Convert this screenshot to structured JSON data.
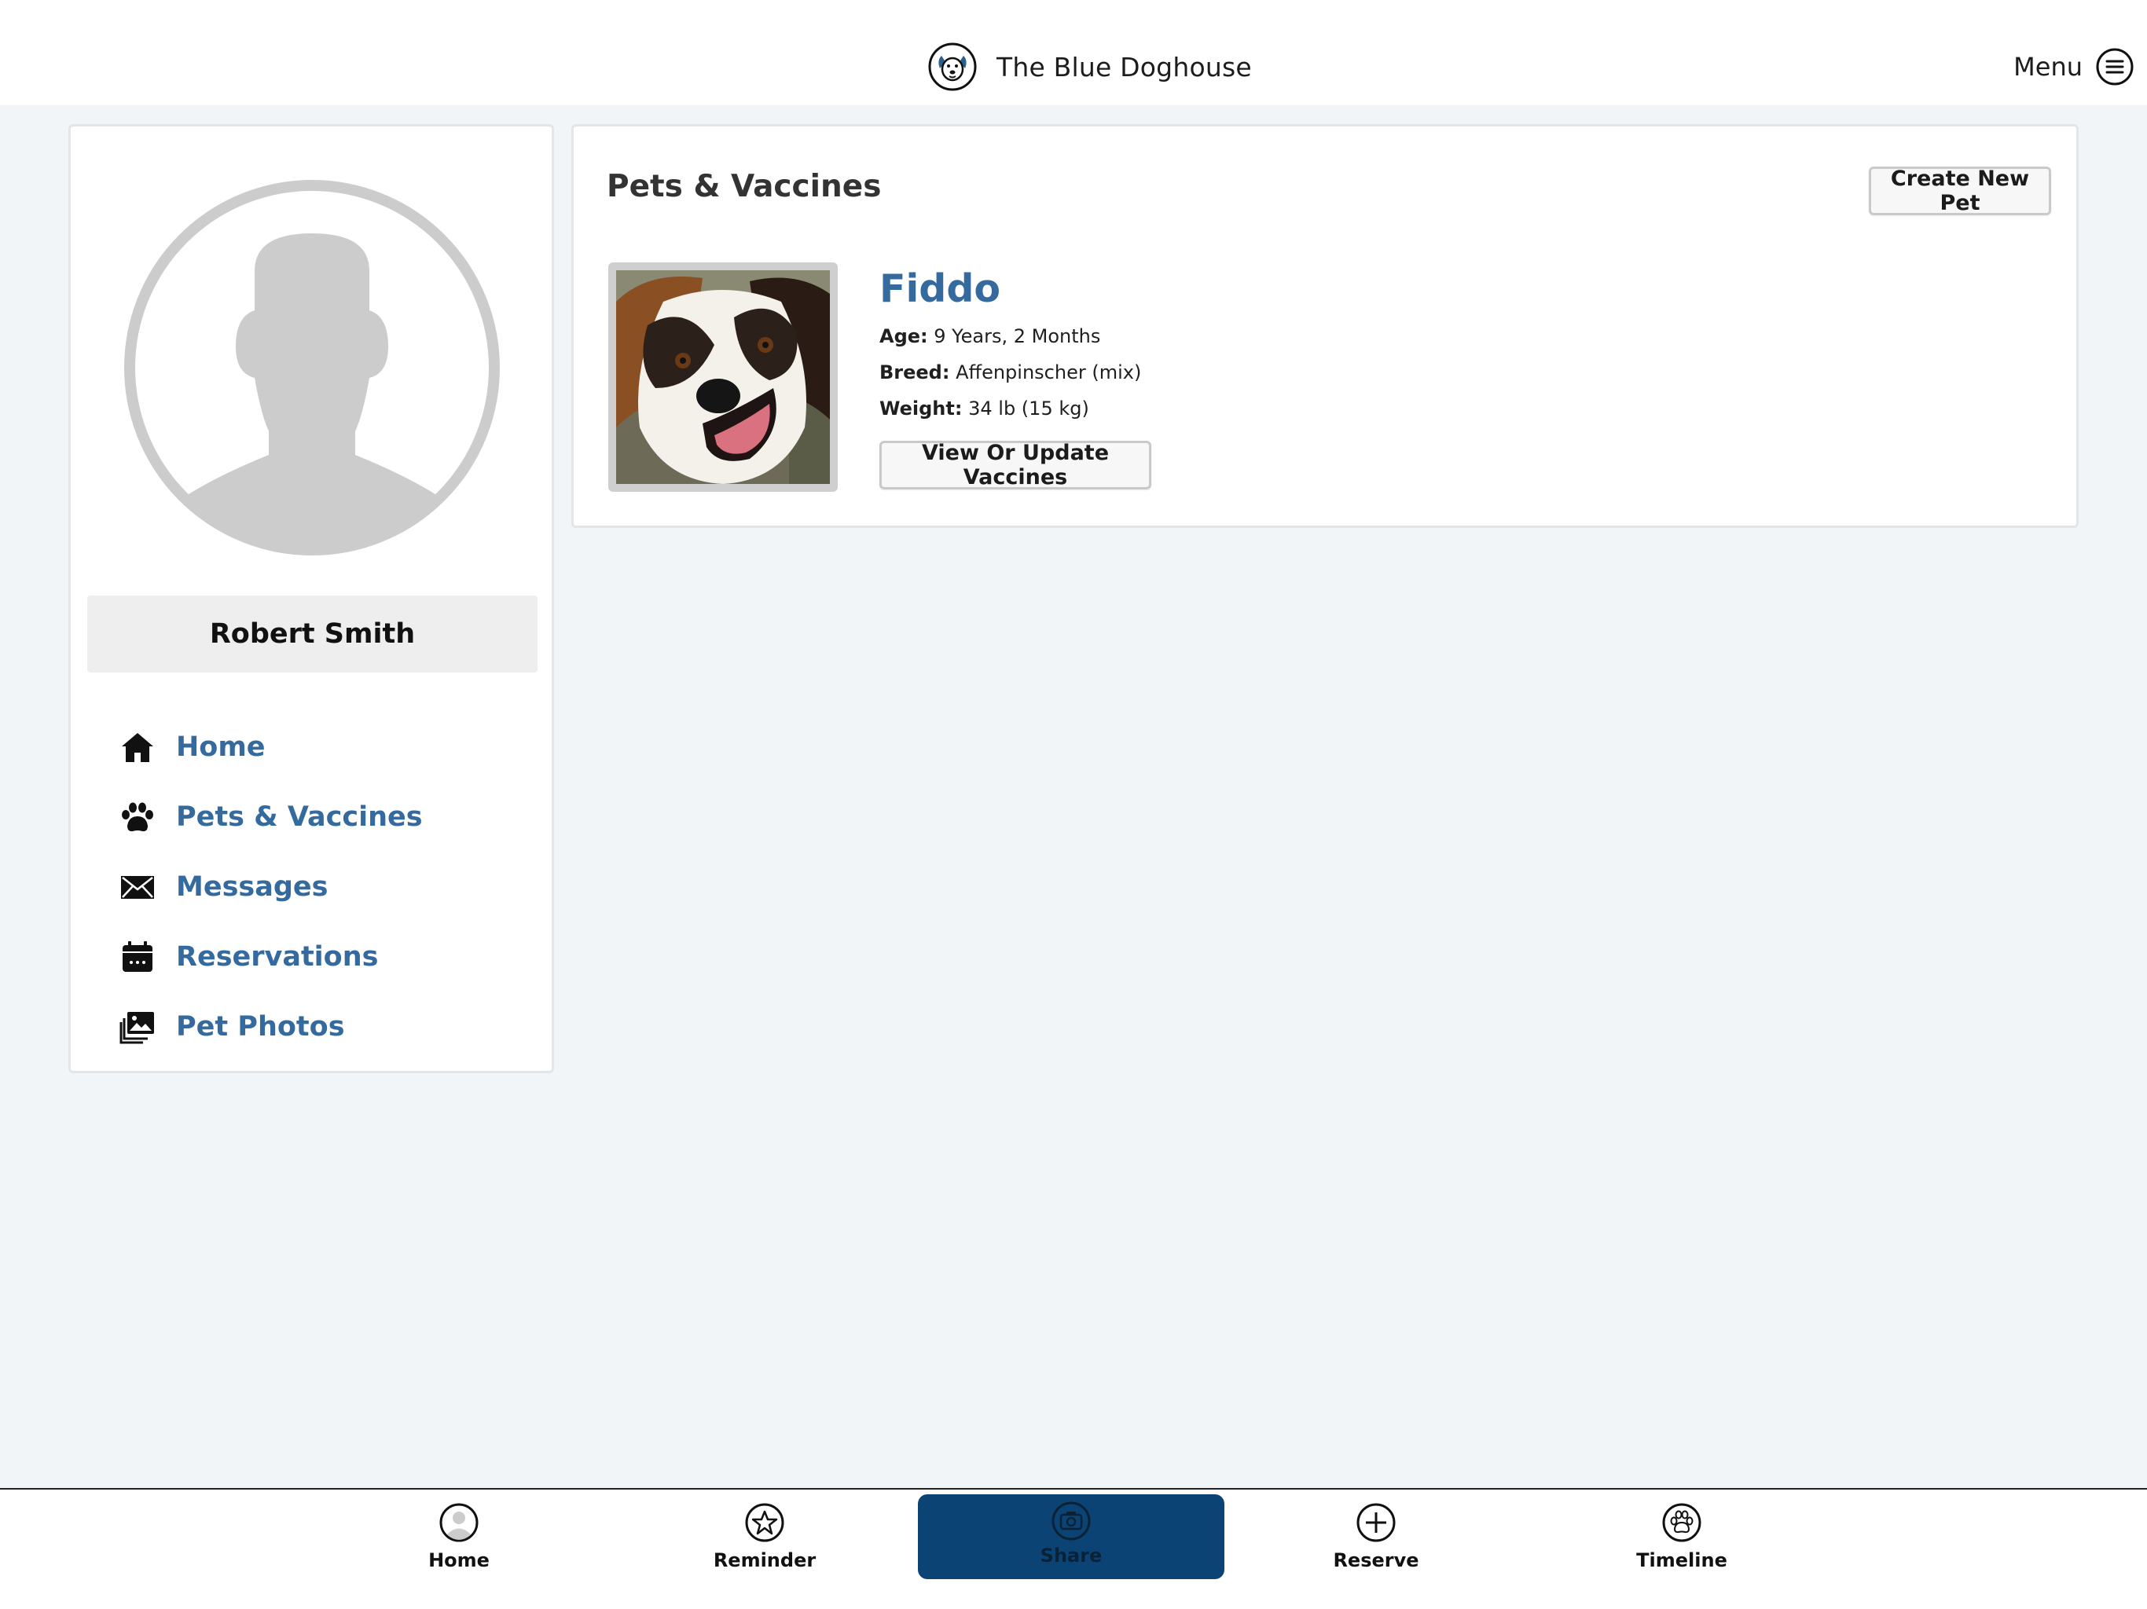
{
  "header": {
    "brand_title": "The Blue Doghouse",
    "menu_label": "Menu",
    "logo_icon": "dog-logo-icon",
    "menu_icon": "hamburger-circle-icon"
  },
  "sidebar": {
    "user_name": "Robert Smith",
    "avatar_icon": "user-silhouette-icon",
    "items": [
      {
        "label": "Home",
        "icon": "house-icon"
      },
      {
        "label": "Pets & Vaccines",
        "icon": "paw-icon"
      },
      {
        "label": "Messages",
        "icon": "envelope-icon"
      },
      {
        "label": "Reservations",
        "icon": "calendar-icon"
      },
      {
        "label": "Pet Photos",
        "icon": "photos-icon"
      }
    ]
  },
  "main": {
    "title": "Pets & Vaccines",
    "create_button": "Create New Pet",
    "pet": {
      "name": "Fiddo",
      "age_label": "Age:",
      "age": "9 Years, 2 Months",
      "breed_label": "Breed:",
      "breed": "Affenpinscher (mix)",
      "weight_label": "Weight:",
      "weight": "34 lb (15 kg)",
      "vaccines_button": "View Or Update Vaccines"
    }
  },
  "tabbar": {
    "active": "Share",
    "tabs": [
      {
        "label": "Home",
        "icon": "person-circle-icon"
      },
      {
        "label": "Reminder",
        "icon": "star-circle-icon"
      },
      {
        "label": "Share",
        "icon": "camera-circle-icon"
      },
      {
        "label": "Reserve",
        "icon": "plus-circle-icon"
      },
      {
        "label": "Timeline",
        "icon": "paw-circle-icon"
      }
    ]
  },
  "colors": {
    "background": "#f2f5f8",
    "link_blue": "#346a9e",
    "active_tab": "#0b4474"
  }
}
